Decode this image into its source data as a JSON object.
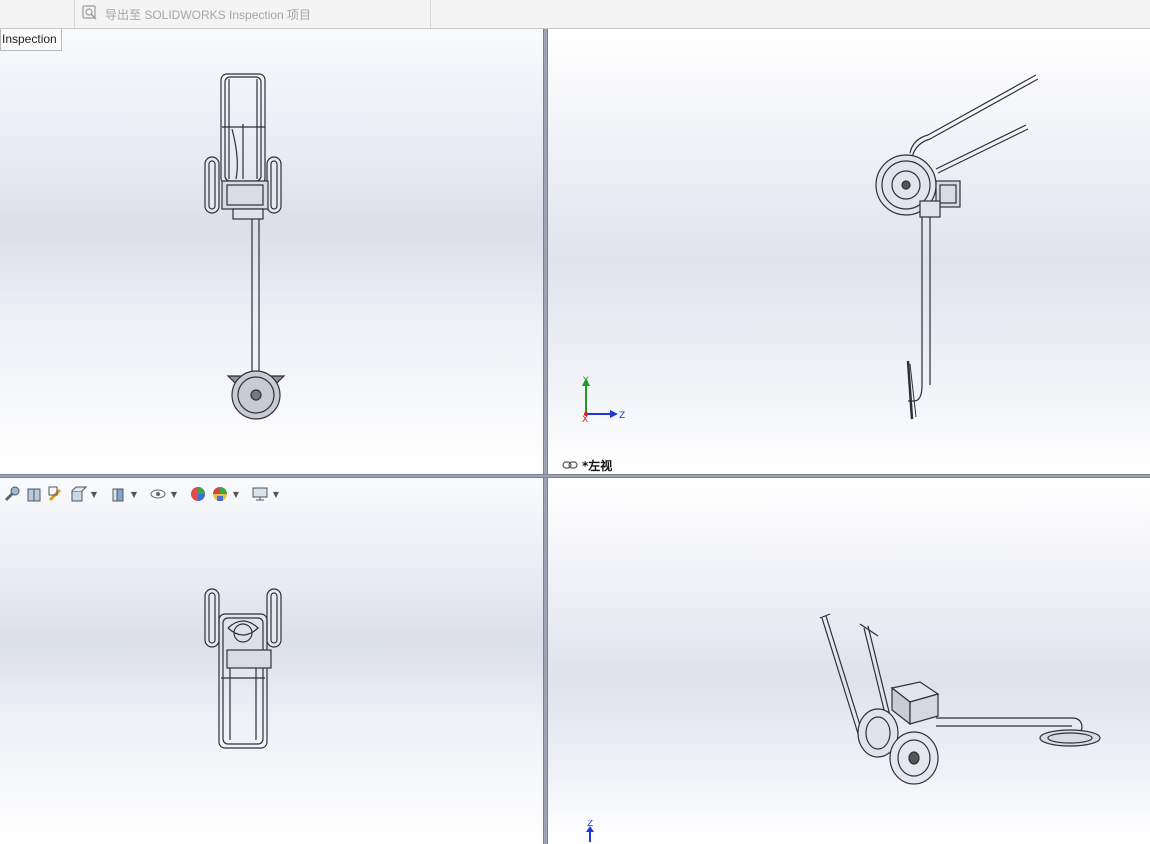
{
  "toolbar": {
    "export_label": "导出至 SOLIDWORKS Inspection 项目",
    "tab_label": "Inspection"
  },
  "viewports": {
    "top_right": {
      "label": "*左视"
    },
    "axes": {
      "x": "X",
      "y": "Y",
      "z": "Z"
    }
  },
  "heads_up_toolbar": {
    "icons": [
      "zoom-to-fit-icon",
      "section-view-icon",
      "dynamic-annotation-icon",
      "view-orientation-icon",
      "display-style-icon",
      "hide-show-items-icon",
      "edit-appearance-icon",
      "apply-scene-icon",
      "view-settings-icon"
    ]
  },
  "colors": {
    "axis_x": "#d62020",
    "axis_y": "#1f9a2a",
    "axis_z": "#2036d6",
    "model_stroke": "#2e2f3a",
    "model_fill": "#d9dbe4"
  }
}
